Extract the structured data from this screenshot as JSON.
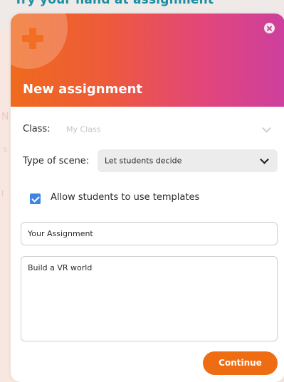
{
  "background": {
    "heading": "Try your hand at assignment",
    "faint_text_1": "N",
    "faint_text_2": "S",
    "faint_text_3": "I"
  },
  "modal": {
    "title": "New assignment",
    "icons": {
      "header": "plus-icon",
      "close": "close-icon",
      "checkbox_mark": "check-icon",
      "dropdown": "chevron-down-icon"
    },
    "colors": {
      "gradient_start": "#ef6a1d",
      "gradient_end": "#cd3f9e",
      "accent": "#ef6d12",
      "checkbox": "#3f85e0"
    },
    "class_field": {
      "label": "Class:",
      "selected": "My Class"
    },
    "scene_field": {
      "label": "Type of scene:",
      "selected": "Let students decide"
    },
    "templates_checkbox": {
      "label": "Allow students to use templates",
      "checked": true
    },
    "assignment_name": {
      "value": "Your Assignment"
    },
    "assignment_description": {
      "value": "Build a VR world"
    },
    "continue_label": "Continue"
  }
}
